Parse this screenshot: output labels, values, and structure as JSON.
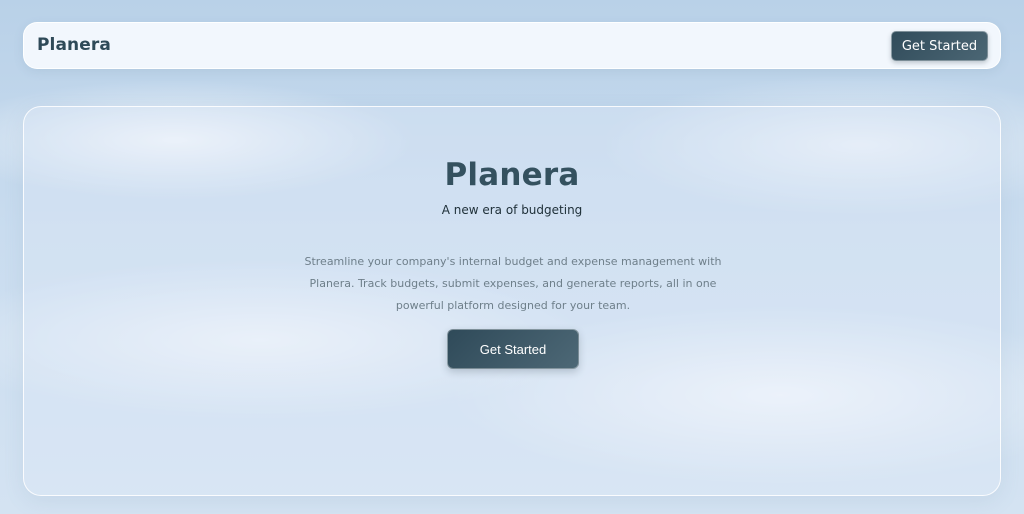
{
  "navbar": {
    "brand": "Planera",
    "cta_label": "Get Started"
  },
  "hero": {
    "title": "Planera",
    "subtitle": "A new era of budgeting",
    "description": "Streamline your company's internal budget and expense management with Planera. Track budgets, submit expenses, and generate reports, all in one powerful platform designed for your team.",
    "cta_label": "Get Started"
  },
  "colors": {
    "brand_text": "#2f4a58",
    "button": "#314c5b",
    "background": "#c9dcef",
    "description_text": "#6e7f8a"
  }
}
